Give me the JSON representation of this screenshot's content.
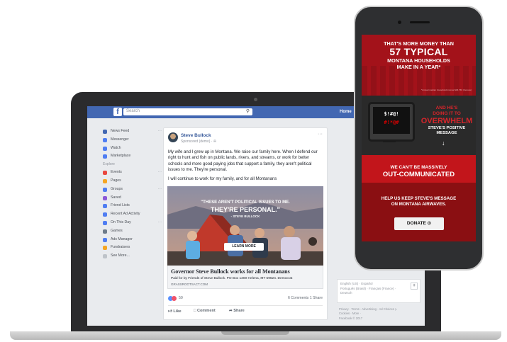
{
  "facebook": {
    "search_placeholder": "Search",
    "home_label": "Home",
    "logo_letter": "f"
  },
  "sidebar": {
    "items": [
      {
        "label": "News Feed",
        "icon": "news-feed-icon",
        "color": "#4267b2"
      },
      {
        "label": "Messenger",
        "icon": "messenger-icon",
        "color": "#4f7df2"
      },
      {
        "label": "Watch",
        "icon": "watch-icon",
        "color": "#4f7df2"
      },
      {
        "label": "Marketplace",
        "icon": "marketplace-icon",
        "color": "#4f7df2"
      }
    ],
    "explore_label": "Explore",
    "explore_items": [
      {
        "label": "Events",
        "icon": "events-icon",
        "color": "#e9473f"
      },
      {
        "label": "Pages",
        "icon": "pages-icon",
        "color": "#f5a623"
      },
      {
        "label": "Groups",
        "icon": "groups-icon",
        "color": "#4f7df2"
      },
      {
        "label": "Saved",
        "icon": "saved-icon",
        "color": "#8c59d8"
      },
      {
        "label": "Friend Lists",
        "icon": "friend-lists-icon",
        "color": "#4f7df2"
      },
      {
        "label": "Recent Ad Activity",
        "icon": "ad-activity-icon",
        "color": "#4f7df2"
      },
      {
        "label": "On This Day",
        "icon": "on-this-day-icon",
        "color": "#4f7df2"
      },
      {
        "label": "Games",
        "icon": "games-icon",
        "color": "#6d7b8a"
      },
      {
        "label": "Ads Manager",
        "icon": "ads-manager-icon",
        "color": "#4f7df2"
      },
      {
        "label": "Fundraisers",
        "icon": "fundraisers-icon",
        "color": "#f5a623"
      }
    ],
    "see_more": "See More..."
  },
  "post": {
    "author": "Steve Bullock",
    "sponsored": "Sponsored (demo) · ✇",
    "paragraph1": "My wife and I grew up in Montana. We raise our family here. When I defend our right to hunt and fish on public lands, rivers, and streams, or work for better schools and more good paying jobs that support a family, they aren't political issues to me. They're personal.",
    "paragraph2": "I will continue to work for my family, and for all Montanans",
    "image_quote_1": "\"THESE AREN'T POLITICAL ISSUES TO ME.",
    "image_quote_2": "THEY'RE PERSONAL.\"",
    "image_attribution": "- STEVE BULLOCK",
    "learn_more": "LEARN MORE",
    "headline": "Governor Steve Bullock works for all Montanans",
    "paid_for": "Paid for by Friends of Steve Bullock. PO Box 1300 Helena, MT 59624. Democrat",
    "domain": "GRASSROOTSACT.COM",
    "reaction_count": "50",
    "comments_shares": "6 Comments  1 Share",
    "like": "Like",
    "comment": "Comment",
    "share": "Share"
  },
  "rightcol": {
    "languages_1": "English (US) · Español",
    "languages_2": "Português (Brasil) · Français (France) ·",
    "languages_3": "Deutsch",
    "footer_1": "Privacy · Terms · Advertising · Ad Choices ▷",
    "footer_2": "Cookies · More ·",
    "footer_3": "Facebook © 2017"
  },
  "mobile_ad": {
    "line1": "THAT'S MORE MONEY THAN",
    "line2": "57 TYPICAL",
    "line3": "MONTANA HOUSEHOLDS",
    "line4": "MAKE IN A YEAR*",
    "footnote": "*Annual median household income $46,766 (Census)",
    "tv_text_1": "$!#@!",
    "tv_text_2": "#!*@#",
    "right1": "AND HE'S",
    "right2": "DOING IT TO",
    "right3": "OVERWHELM",
    "right4": "STEVE'S POSITIVE",
    "right5": "MESSAGE",
    "we_cant": "WE CAN'T BE MASSIVELY",
    "out_communicated": "OUT-COMMUNICATED",
    "help1": "HELP US KEEP STEVE'S MESSAGE",
    "help2": "ON MONTANA AIRWAVES.",
    "donate": "DONATE ⊙"
  }
}
